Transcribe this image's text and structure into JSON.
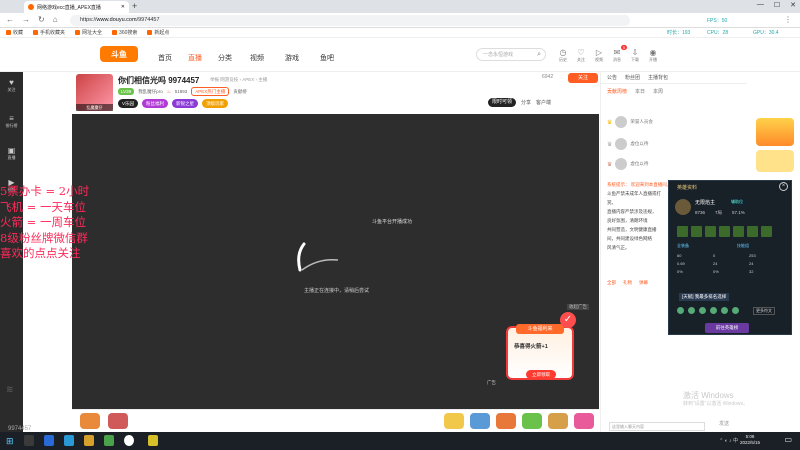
{
  "browser": {
    "tab_title": "网络游戏ecc直播_APEX直播",
    "url_scheme": "https://",
    "url_host": "www.douyu.com",
    "url_path": "/9974457",
    "bookmarks": [
      "收藏",
      "手机收藏夹",
      "网址大全",
      "360搜索",
      "新起点"
    ]
  },
  "site": {
    "logo": "斗鱼",
    "nav": [
      "首页",
      "直播",
      "分类",
      "视频",
      "游戏",
      "鱼吧"
    ],
    "search_placeholder": "一念永恒游戏",
    "header_icons": [
      {
        "icon": "history-icon",
        "label": "历史"
      },
      {
        "icon": "follow-icon",
        "label": "关注"
      },
      {
        "icon": "video-icon",
        "label": "视频"
      },
      {
        "icon": "message-icon",
        "label": "消息",
        "badge": "5"
      },
      {
        "icon": "download-icon",
        "label": "下载"
      },
      {
        "icon": "broadcast-icon",
        "label": "开播"
      }
    ]
  },
  "sidebar": [
    {
      "icon": "heart-icon",
      "label": "关注"
    },
    {
      "icon": "rank-icon",
      "label": "排行榜"
    },
    {
      "icon": "tv-icon",
      "label": "直播"
    },
    {
      "icon": "video-icon",
      "label": "视频"
    }
  ],
  "room": {
    "title": "你们相信光吗 9974457",
    "categories": "举报   网游竞技 › APEX › 主播",
    "anchor": "乱魔魔仔",
    "anchor_level": "LV39",
    "anchor_name": "我乱魔仔pro",
    "hot": "51893",
    "tag1": "APEX热门主播",
    "tag2": "贡献榜",
    "badges": [
      "V乐园",
      "粉丝福利",
      "新锐之星",
      "顶级玩家"
    ],
    "viewer_count": "6942",
    "follow_label": "关注",
    "controls": [
      "限时可领",
      "分享",
      "客户端"
    ]
  },
  "video": {
    "status1": "斗鱼平台开播成功",
    "status2": "主播正在连接中，请稍后尝试",
    "collapse": "收起广告",
    "ad": {
      "title": "斗鱼福利来",
      "message": "恭喜得火箭+1",
      "button": "立即领取"
    },
    "ad_label": "广告"
  },
  "overlay_lines": [
    "5票办卡 = 2小时",
    "飞机 = 一天车位",
    "火箭 = 一周车位",
    "8级粉丝牌微信群",
    "喜欢的点点关注"
  ],
  "right_panel": {
    "tabs": [
      "公告",
      "粉丝团",
      "主播背包"
    ],
    "rank_tabs": [
      "贡献周榜",
      "本日",
      "本周"
    ],
    "rank_rows": [
      "荣誉人员会",
      "虚位以待",
      "虚位以待"
    ],
    "chat_lines": [
      "系统提示：  欢迎来到本直播间，",
      "斗鱼严禁未成年人直播或打",
      "赏。",
      "直播内容严禁涉及违规，",
      "良好氛围，清朗环境",
      "共同营造，文明健康直播",
      "间，共同建设绿色网络",
      "风清气正。"
    ],
    "chat_tabs": [
      "全部",
      "礼物",
      "弹幕"
    ],
    "input_placeholder": "这里输入聊天内容",
    "send": "发送"
  },
  "hero_window": {
    "title": "英雄资料",
    "name": "无限焰主",
    "label": "辅助位",
    "stats": [
      "8736",
      "7局",
      "57.1%"
    ],
    "section1": "全装备",
    "section2": "技能组",
    "grid": [
      "60",
      "0",
      "253",
      "0.69",
      "24",
      "24",
      "0%",
      "0%",
      "32"
    ],
    "tag": "[天赋]",
    "tag_text": "我最多排名选择",
    "more": "更多符文",
    "button": "前往英雄榜"
  },
  "perf": {
    "fps_label": "FPS：50",
    "time_label": "时长：193",
    "cpu_label": "CPU：28",
    "gpu_label": "GPU：30.4"
  },
  "windows": {
    "watermark_title": "激活 Windows",
    "watermark_sub": "转到“设置”以激活 Windows。",
    "time": "5:08",
    "date": "2022/5/15"
  },
  "stream_id": "9974457"
}
